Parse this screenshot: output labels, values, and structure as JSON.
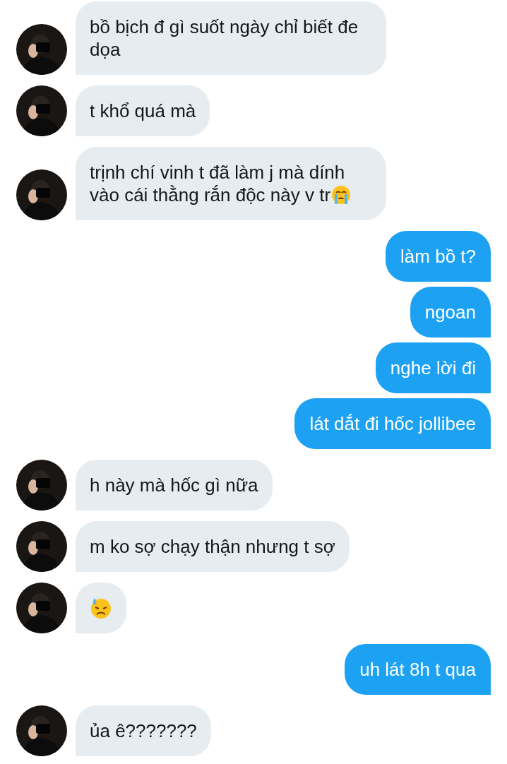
{
  "messages": [
    {
      "outgoing": false,
      "kind": "text",
      "text": "bồ bịch đ gì suốt ngày chỉ biết đe dọa"
    },
    {
      "outgoing": false,
      "kind": "text",
      "text": "t khổ quá mà"
    },
    {
      "outgoing": false,
      "kind": "text_emoji",
      "text": "trịnh chí vinh t đã làm j mà dính vào cái thằng rắn độc này v tr"
    },
    {
      "outgoing": true,
      "kind": "text",
      "text": "làm bồ t?"
    },
    {
      "outgoing": true,
      "kind": "text",
      "text": "ngoan"
    },
    {
      "outgoing": true,
      "kind": "text",
      "text": "nghe lời đi"
    },
    {
      "outgoing": true,
      "kind": "text",
      "text": "lát dắt đi hốc jollibee"
    },
    {
      "outgoing": false,
      "kind": "text",
      "text": "h này mà hốc gì nữa"
    },
    {
      "outgoing": false,
      "kind": "text",
      "text": "m ko sợ chạy thận nhưng t sợ"
    },
    {
      "outgoing": false,
      "kind": "emoji"
    },
    {
      "outgoing": true,
      "kind": "text",
      "text": "uh lát 8h t qua"
    },
    {
      "outgoing": false,
      "kind": "text",
      "text": "ủa ê???????"
    }
  ]
}
